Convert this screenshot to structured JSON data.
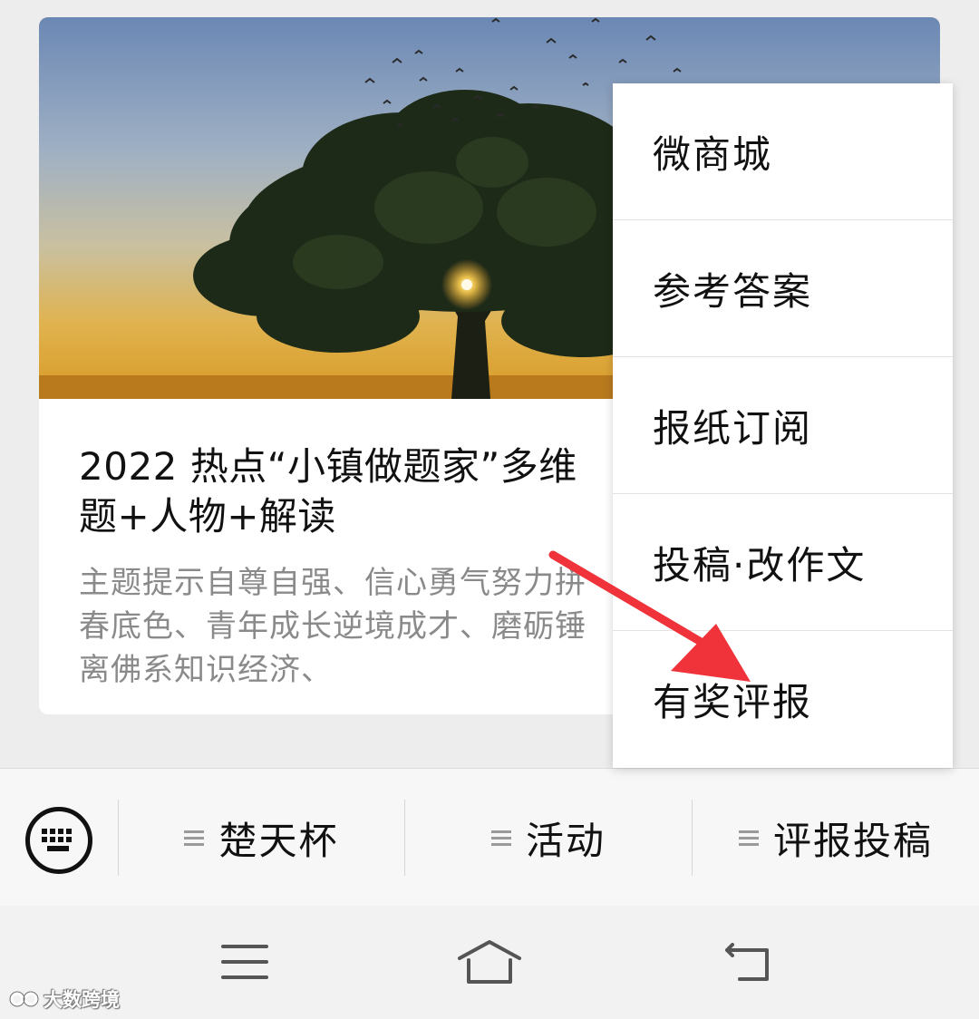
{
  "article": {
    "title": "2022 热点“小镇做题家”多维\n题+人物+解读",
    "digest": "主题提示自尊自强、信心勇气努力拼\n春底色、青年成长逆境成才、磨砺锤\n离佛系知识经济、"
  },
  "popup_menu": {
    "items": [
      {
        "label": "微商城"
      },
      {
        "label": "参考答案"
      },
      {
        "label": "报纸订阅"
      },
      {
        "label": "投稿·改作文"
      },
      {
        "label": "有奖评报"
      }
    ]
  },
  "menubar": {
    "keyboard_icon": "keyboard-icon",
    "items": [
      {
        "label": "楚天杯",
        "icon": "menu-lines-icon"
      },
      {
        "label": "活动",
        "icon": "menu-lines-icon"
      },
      {
        "label": "评报投稿",
        "icon": "menu-lines-icon"
      }
    ]
  },
  "navbar": {
    "menu_icon": "hamburger-icon",
    "home_icon": "home-icon",
    "back_icon": "back-icon"
  },
  "watermark": {
    "text": "大数跨境"
  },
  "colors": {
    "arrow": "#f0333a",
    "background": "#ededed",
    "digest_text": "#8a8a8a"
  }
}
